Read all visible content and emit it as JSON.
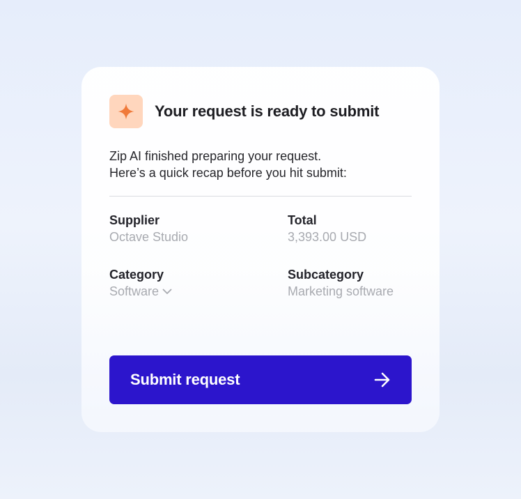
{
  "header": {
    "icon": "sparkle-icon",
    "title": "Your request is ready to submit"
  },
  "intro": {
    "line1": "Zip AI finished preparing your request.",
    "line2": "Here’s a quick recap before you hit submit:"
  },
  "fields": {
    "supplier": {
      "label": "Supplier",
      "value": "Octave Studio"
    },
    "total": {
      "label": "Total",
      "value": "3,393.00 USD"
    },
    "category": {
      "label": "Category",
      "value": "Software",
      "icon": "chevron-down-icon"
    },
    "subcategory": {
      "label": "Subcategory",
      "value": "Marketing software"
    }
  },
  "actions": {
    "submit_label": "Submit request",
    "submit_icon": "arrow-right-icon"
  },
  "colors": {
    "accent": "#2c15cc",
    "icon_badge": "#ffd6bd",
    "sparkle": "#f07a3a",
    "muted_text": "#a8aab0"
  }
}
